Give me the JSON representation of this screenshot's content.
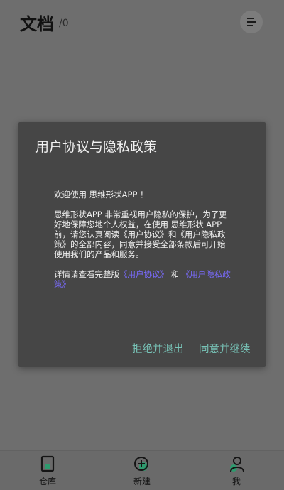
{
  "header": {
    "title": "文档",
    "count": "/0",
    "menu_icon": "list-menu-icon"
  },
  "dialog": {
    "title": "用户协议与隐私政策",
    "welcome": "欢迎使用 思维形状APP ！",
    "paragraph": "思维形状APP 非常重视用户隐私的保护，为了更好地保障您地个人权益，在使用 思维形状 APP 前，请您认真阅读《用户协议》和《用户隐私政策》的全部内容，同意并接受全部条款后可开始使用我们的产品和服务。",
    "details_prefix": "详情请查看完整版",
    "link_user_agreement": "《用户协议》",
    "details_and": "和",
    "link_privacy_policy": "《用户隐私政策》",
    "reject_label": "拒绝并退出",
    "agree_label": "同意并继续",
    "link_color": "#7a6bff",
    "button_color": "#78c4b8"
  },
  "bottom_nav": {
    "items": [
      {
        "label": "仓库",
        "icon": "library-icon",
        "active": true
      },
      {
        "label": "新建",
        "icon": "add-circle-icon",
        "active": false
      },
      {
        "label": "我",
        "icon": "user-icon",
        "active": false
      }
    ],
    "accent": "#2e9a6e"
  }
}
